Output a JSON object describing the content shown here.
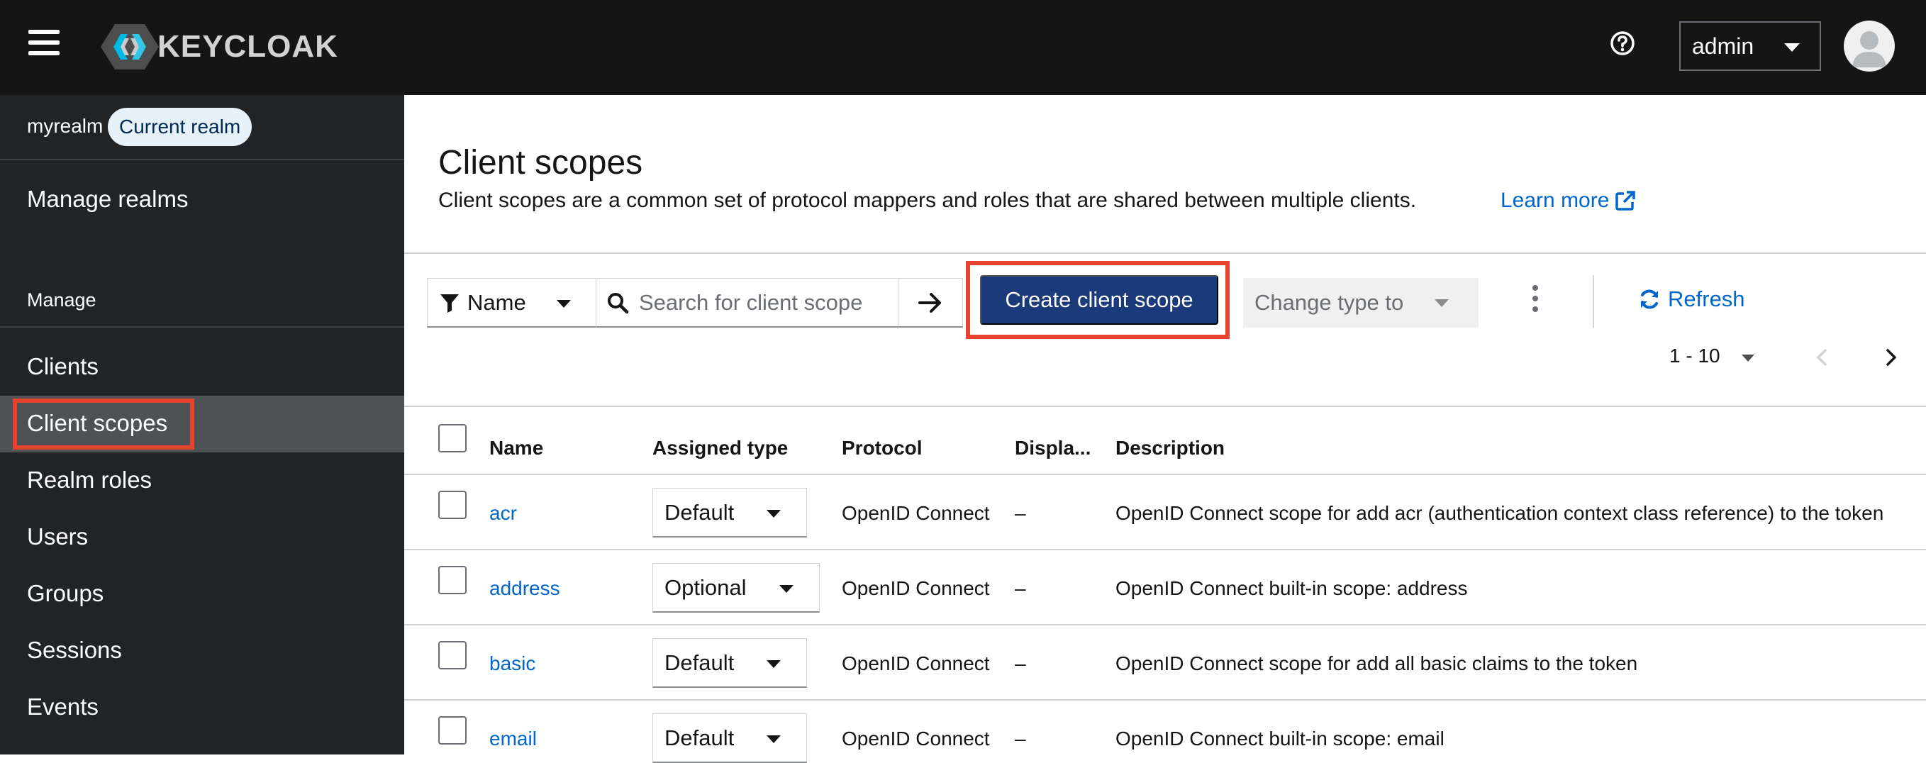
{
  "masthead": {
    "brand": "KEYCLOAK",
    "user": "admin"
  },
  "sidebar": {
    "realm_name": "myrealm",
    "realm_badge": "Current realm",
    "manage_realms": "Manage realms",
    "section_title": "Manage",
    "items": [
      {
        "label": "Clients"
      },
      {
        "label": "Client scopes"
      },
      {
        "label": "Realm roles"
      },
      {
        "label": "Users"
      },
      {
        "label": "Groups"
      },
      {
        "label": "Sessions"
      },
      {
        "label": "Events"
      }
    ]
  },
  "main": {
    "title": "Client scopes",
    "description": "Client scopes are a common set of protocol mappers and roles that are shared between multiple clients.",
    "learn_more": "Learn more"
  },
  "toolbar": {
    "filter_label": "Name",
    "search_placeholder": "Search for client scope",
    "create_label": "Create client scope",
    "change_type_label": "Change type to",
    "refresh_label": "Refresh",
    "pagination": "1 - 10"
  },
  "table": {
    "headers": {
      "name": "Name",
      "assigned_type": "Assigned type",
      "protocol": "Protocol",
      "display": "Displa...",
      "description": "Description"
    },
    "rows": [
      {
        "name": "acr",
        "type": "Default",
        "protocol": "OpenID Connect",
        "display": "–",
        "description": "OpenID Connect scope for add acr (authentication context class reference) to the token"
      },
      {
        "name": "address",
        "type": "Optional",
        "protocol": "OpenID Connect",
        "display": "–",
        "description": "OpenID Connect built-in scope: address"
      },
      {
        "name": "basic",
        "type": "Default",
        "protocol": "OpenID Connect",
        "display": "–",
        "description": "OpenID Connect scope for add all basic claims to the token"
      },
      {
        "name": "email",
        "type": "Default",
        "protocol": "OpenID Connect",
        "display": "–",
        "description": "OpenID Connect built-in scope: email"
      }
    ]
  },
  "colors": {
    "masthead_bg": "#151515",
    "sidebar_bg": "#212427",
    "active_nav_bg": "#4f5255",
    "primary_button": "#1a3a7a",
    "link": "#0066cc",
    "highlight_box": "#e8432e"
  }
}
